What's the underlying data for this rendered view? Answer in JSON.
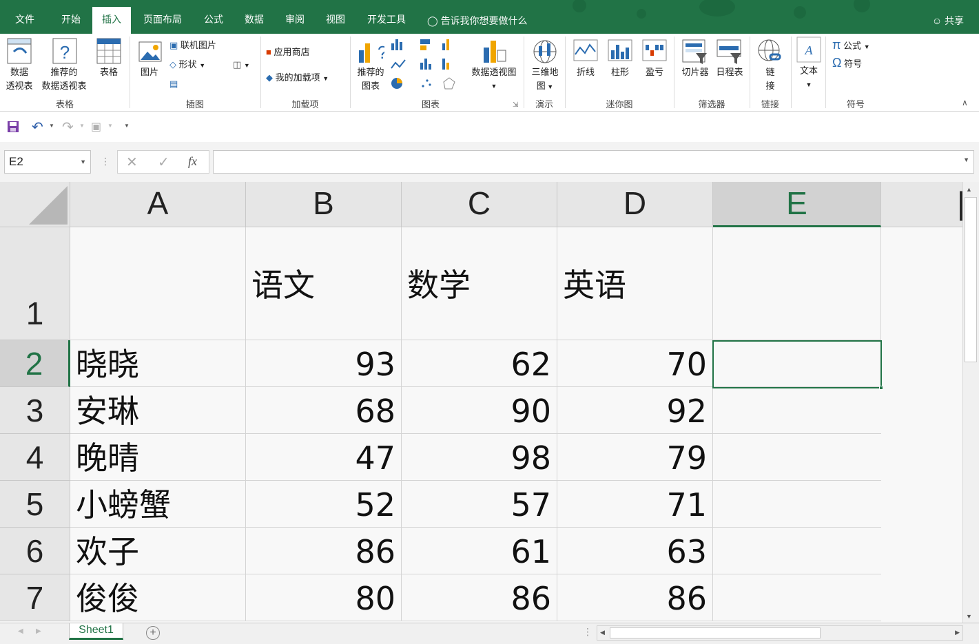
{
  "menu": {
    "tabs": [
      "文件",
      "开始",
      "插入",
      "页面布局",
      "公式",
      "数据",
      "审阅",
      "视图",
      "开发工具"
    ],
    "active_tab": "插入",
    "tell_me": "告诉我你想要做什么",
    "share": "共享"
  },
  "ribbon": {
    "groups": {
      "tables": "表格",
      "illustrations": "插图",
      "addins": "加载项",
      "charts": "图表",
      "tours": "演示",
      "sparklines": "迷你图",
      "filters": "筛选器",
      "links": "链接",
      "symbols": "符号"
    },
    "pivot_table": [
      "数据",
      "透视表"
    ],
    "recommended_pivot": [
      "推荐的",
      "数据透视表"
    ],
    "table": "表格",
    "pictures": "图片",
    "online_pictures": "联机图片",
    "shapes": "形状",
    "store": "应用商店",
    "my_addins": "我的加载项",
    "recommended_charts": [
      "推荐的",
      "图表"
    ],
    "pivot_chart": "数据透视图",
    "map3d": [
      "三维地",
      "图"
    ],
    "spark_line": "折线",
    "spark_column": "柱形",
    "spark_winloss": "盈亏",
    "slicer": "切片器",
    "timeline": "日程表",
    "link": [
      "链",
      "接"
    ],
    "text": "文本",
    "equation": "公式",
    "symbol": "符号"
  },
  "formula_bar": {
    "name_box": "E2",
    "fx": "fx",
    "value": ""
  },
  "sheet": {
    "columns": [
      "A",
      "B",
      "C",
      "D",
      "E"
    ],
    "selected_column": "E",
    "selected_row": "2",
    "header_row": {
      "row": "1",
      "cells": [
        "",
        "语文",
        "数学",
        "英语",
        ""
      ]
    },
    "rows": [
      {
        "row": "2",
        "cells": [
          "晓晓",
          "93",
          "62",
          "70",
          ""
        ]
      },
      {
        "row": "3",
        "cells": [
          "安琳",
          "68",
          "90",
          "92",
          ""
        ]
      },
      {
        "row": "4",
        "cells": [
          "晚晴",
          "47",
          "98",
          "79",
          ""
        ]
      },
      {
        "row": "5",
        "cells": [
          "小螃蟹",
          "52",
          "57",
          "71",
          ""
        ]
      },
      {
        "row": "6",
        "cells": [
          "欢子",
          "86",
          "61",
          "63",
          ""
        ]
      },
      {
        "row": "7",
        "cells": [
          "俊俊",
          "80",
          "86",
          "86",
          ""
        ]
      }
    ],
    "tab_name": "Sheet1"
  },
  "colors": {
    "brand_green": "#217346"
  }
}
